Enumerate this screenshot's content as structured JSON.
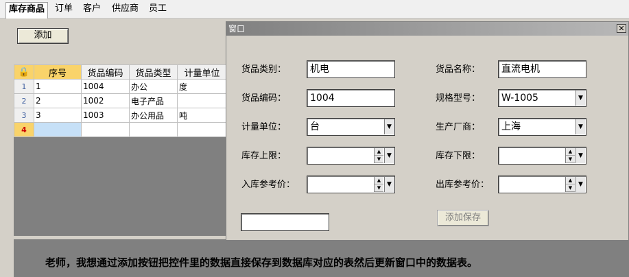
{
  "menu": {
    "items": [
      "库存商品",
      "订单",
      "客户",
      "供应商",
      "员工"
    ]
  },
  "toolbar": {
    "add_label": "添加"
  },
  "grid": {
    "columns": [
      "序号",
      "货品编码",
      "货品类型",
      "计量单位"
    ],
    "rows": [
      {
        "num": "1",
        "cells": [
          "1",
          "1004",
          "办公",
          "度"
        ]
      },
      {
        "num": "2",
        "cells": [
          "2",
          "1002",
          "电子产品",
          ""
        ]
      },
      {
        "num": "3",
        "cells": [
          "3",
          "1003",
          "办公用品",
          "吨"
        ]
      }
    ],
    "new_row_num": "4"
  },
  "window": {
    "title": "窗口",
    "close_glyph": "✕",
    "fields": {
      "category_label": "货品类别：",
      "category_value": "机电",
      "name_label": "货品名称：",
      "name_value": "直流电机",
      "code_label": "货品编码：",
      "code_value": "1004",
      "model_label": "规格型号：",
      "model_value": "W-1005",
      "unit_label": "计量单位：",
      "unit_value": "台",
      "maker_label": "生产厂商：",
      "maker_value": "上海",
      "stock_upper_label": "库存上限：",
      "stock_upper_value": "",
      "stock_lower_label": "库存下限：",
      "stock_lower_value": "",
      "in_price_label": "入库参考价：",
      "in_price_value": "",
      "out_price_label": "出库参考价：",
      "out_price_value": ""
    },
    "extra_input_value": "",
    "save_label": "添加保存"
  },
  "caption": "老师，我想通过添加按钮把控件里的数据直接保存到数据库对应的表然后更新窗口中的数据表。"
}
